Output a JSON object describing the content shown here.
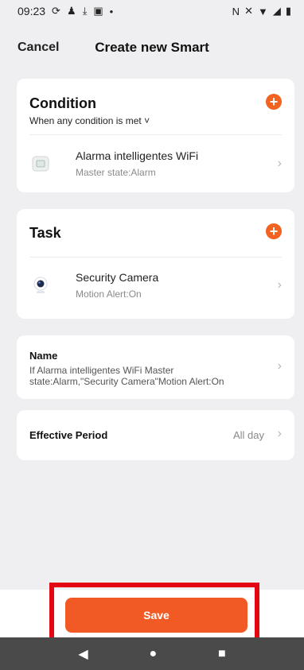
{
  "status_bar": {
    "time": "09:23",
    "left_icons": [
      "sync-icon",
      "person-icon",
      "download-done-icon",
      "media-icon",
      "dot-icon"
    ],
    "right_icons": [
      "nfc-icon",
      "mute-icon",
      "wifi-icon",
      "signal-icon",
      "battery-icon"
    ]
  },
  "header": {
    "cancel_label": "Cancel",
    "title": "Create new Smart"
  },
  "condition": {
    "title": "Condition",
    "subtitle": "When any condition is met ˅",
    "items": [
      {
        "name": "Alarma intelligentes WiFi",
        "detail": "Master state:Alarm",
        "icon": "alarm-panel-icon"
      }
    ]
  },
  "task": {
    "title": "Task",
    "items": [
      {
        "name": "Security Camera",
        "detail": "Motion Alert:On",
        "icon": "camera-icon"
      }
    ]
  },
  "name_card": {
    "label": "Name",
    "value_line1": "If Alarma intelligentes WiFi Master",
    "value_line2": "state:Alarm,\"Security Camera\"Motion Alert:On"
  },
  "effective_period": {
    "label": "Effective Period",
    "value": "All day"
  },
  "save_label": "Save",
  "nav": {
    "back": "◀",
    "home": "●",
    "recents": "■"
  },
  "colors": {
    "accent": "#f15a24",
    "highlight": "#e30613"
  }
}
